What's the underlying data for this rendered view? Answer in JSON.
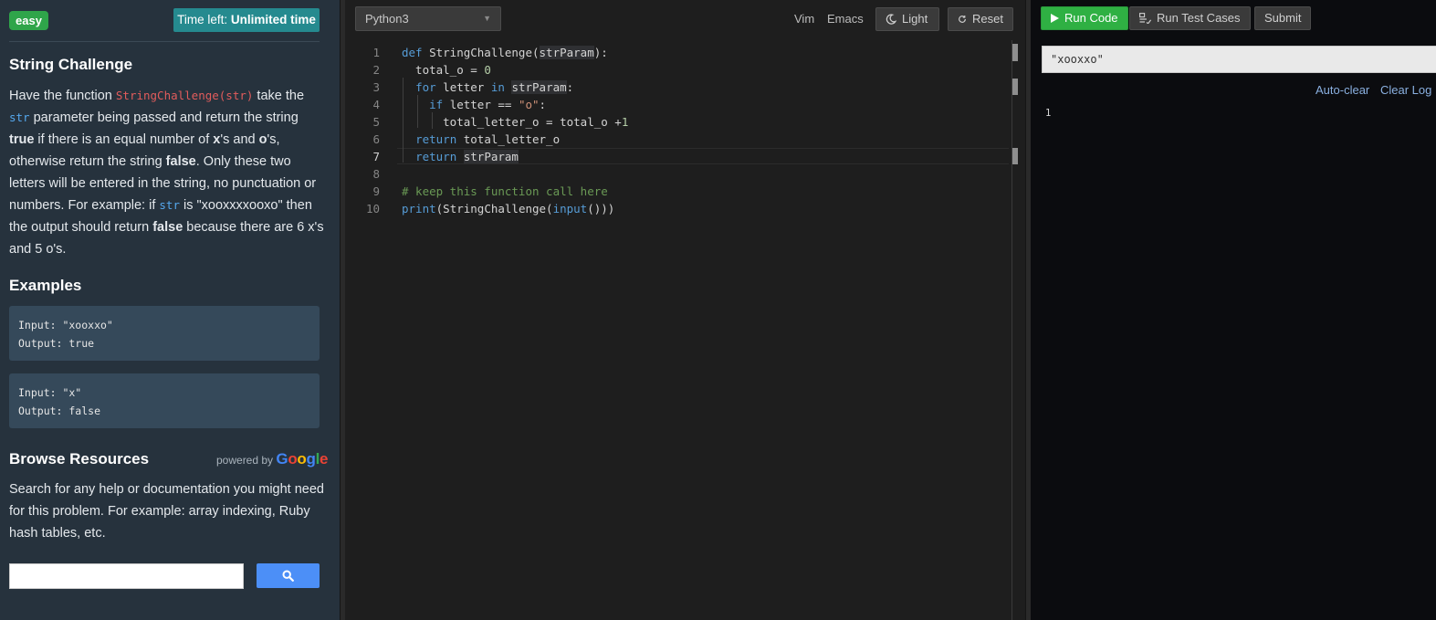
{
  "problem": {
    "difficulty": "easy",
    "time_label": "Time left:",
    "time_value": "Unlimited time",
    "title": "String Challenge",
    "description": {
      "p1": "Have the function ",
      "fn_code": "StringChallenge(str)",
      "p2": " take the ",
      "param_code": "str",
      "p3": " parameter being passed and return the string ",
      "true_word": "true",
      "p4": " if there is an equal number of ",
      "x_char": "x",
      "p5": "'s and ",
      "o_char": "o",
      "p6": "'s, otherwise return the string ",
      "false_word": "false",
      "p7": ". Only these two letters will be entered in the string, no punctuation or numbers. For example: if ",
      "param_code2": "str",
      "p8": " is \"xooxxxxooxo\" then the output should return ",
      "false_word2": "false",
      "p9": " because there are 6 x's and 5 o's."
    },
    "examples_title": "Examples",
    "examples": [
      {
        "input": "Input: \"xooxxo\"",
        "output": "Output: true"
      },
      {
        "input": "Input: \"x\"",
        "output": "Output: false"
      }
    ],
    "resources_title": "Browse Resources",
    "powered_by": "powered by",
    "google": "Google",
    "resources_text": "Search for any help or documentation you might need for this problem. For example: array indexing, Ruby hash tables, etc.",
    "search_value": ""
  },
  "editor": {
    "language": "Python3",
    "vim_label": "Vim",
    "emacs_label": "Emacs",
    "light_label": "Light",
    "reset_label": "Reset",
    "active_line": 7,
    "lines": [
      {
        "n": "1",
        "t": "def StringChallenge(strParam):"
      },
      {
        "n": "2",
        "t": "  total_o = 0"
      },
      {
        "n": "3",
        "t": "  for letter in strParam:"
      },
      {
        "n": "4",
        "t": "    if letter == \"o\":"
      },
      {
        "n": "5",
        "t": "      total_letter_o = total_o +1"
      },
      {
        "n": "6",
        "t": "  return total_letter_o"
      },
      {
        "n": "7",
        "t": "  return strParam"
      },
      {
        "n": "8",
        "t": ""
      },
      {
        "n": "9",
        "t": "# keep this function call here"
      },
      {
        "n": "10",
        "t": "print(StringChallenge(input()))"
      }
    ]
  },
  "console": {
    "run_code_label": "Run Code",
    "run_tests_label": "Run Test Cases",
    "submit_label": "Submit",
    "stdin_value": "\"xooxxo\"",
    "auto_clear_label": "Auto-clear",
    "clear_log_label": "Clear Log",
    "output": "1"
  },
  "colors": {
    "easy": "#2fa54a",
    "time_box": "#258a8f",
    "run_button": "#2fb043",
    "search_button": "#4c8ff7",
    "keyword": "#569cd6",
    "string": "#ce9178",
    "comment": "#6a9955"
  },
  "icons": {
    "light": "moon-icon",
    "reset": "refresh-icon",
    "run": "play-icon",
    "tests": "list-icon",
    "search": "search-icon",
    "dropdown": "chevron-down-icon"
  }
}
